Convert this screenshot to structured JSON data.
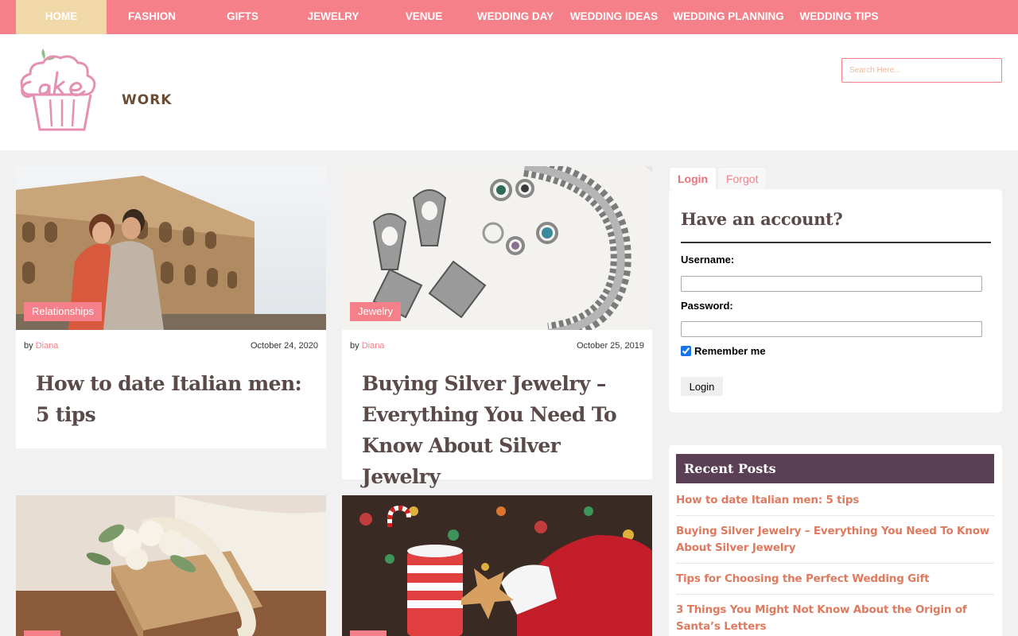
{
  "nav": {
    "items": [
      {
        "label": "HOME"
      },
      {
        "label": "FASHION"
      },
      {
        "label": "GIFTS"
      },
      {
        "label": "JEWELRY"
      },
      {
        "label": "VENUE"
      },
      {
        "label": "WEDDING DAY"
      },
      {
        "label": "WEDDING IDEAS"
      },
      {
        "label": "WEDDING PLANNING"
      },
      {
        "label": "WEDDING TIPS"
      }
    ],
    "active_index": 0
  },
  "header": {
    "logo_text": "CakeWORK",
    "logo_word": "WORK",
    "search_placeholder": "Search Here..."
  },
  "posts": [
    {
      "category": "Relationships",
      "by": "by",
      "author": "Diana",
      "date": "October 24, 2020",
      "title": "How to date Italian men: 5 tips",
      "image": "colosseum-couple"
    },
    {
      "category": "Jewelry",
      "by": "by",
      "author": "Diana",
      "date": "October 25, 2019",
      "title": "Buying Silver Jewelry – Everything You Need To Know About Silver Jewelry",
      "image": "silver-jewelry"
    },
    {
      "category": "",
      "image": "wedding-gift"
    },
    {
      "category": "",
      "image": "santa-cookies"
    }
  ],
  "login": {
    "tabs": [
      {
        "label": "Login"
      },
      {
        "label": "Forgot"
      }
    ],
    "title": "Have an account?",
    "username_label": "Username:",
    "password_label": "Password:",
    "remember_label": "Remember me",
    "remember_checked": true,
    "button_label": "Login"
  },
  "recent": {
    "title": "Recent Posts",
    "items": [
      "How to date Italian men: 5 tips",
      "Buying Silver Jewelry – Everything You Need To Know About Silver Jewelry",
      "Tips for Choosing the Perfect Wedding Gift",
      "3 Things You Might Not Know About the Origin of Santa’s Letters"
    ]
  },
  "colors": {
    "nav_bg": "#f5808a",
    "nav_active_bg": "#f0d8a8",
    "accent": "#f5808a",
    "recent_head_bg": "#5a3f55",
    "recent_link": "#e07a5f"
  }
}
